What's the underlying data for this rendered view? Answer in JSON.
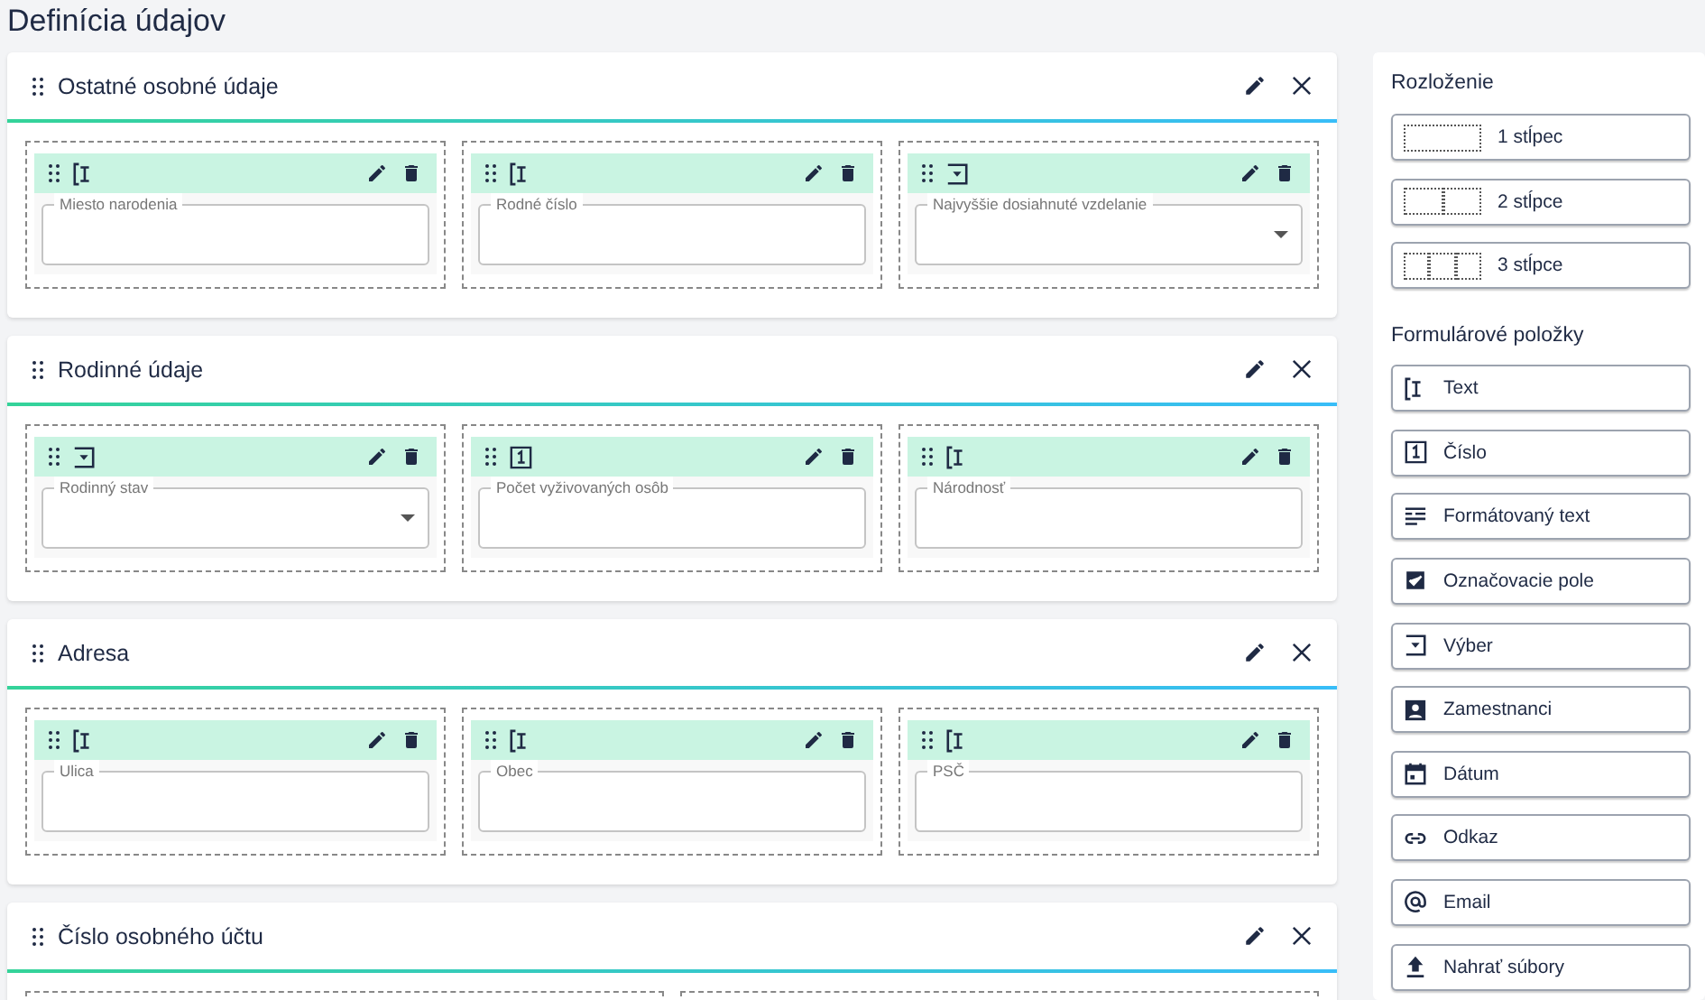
{
  "page_title": "Definícia údajov",
  "sections": [
    {
      "title": "Ostatné osobné údaje",
      "fields": [
        {
          "kind": "text",
          "label": "Miesto narodenia"
        },
        {
          "kind": "text",
          "label": "Rodné číslo"
        },
        {
          "kind": "select",
          "label": "Najvyššie dosiahnuté vzdelanie"
        }
      ]
    },
    {
      "title": "Rodinné údaje",
      "fields": [
        {
          "kind": "select",
          "label": "Rodinný stav"
        },
        {
          "kind": "number",
          "label": "Počet vyživovaných osôb"
        },
        {
          "kind": "text",
          "label": "Národnosť"
        }
      ]
    },
    {
      "title": "Adresa",
      "fields": [
        {
          "kind": "text",
          "label": "Ulica"
        },
        {
          "kind": "text",
          "label": "Obec"
        },
        {
          "kind": "text",
          "label": "PSČ"
        }
      ]
    },
    {
      "title": "Číslo osobného účtu",
      "fields": [
        {
          "kind": "empty"
        },
        {
          "kind": "empty"
        }
      ]
    }
  ],
  "sidebar": {
    "layout_heading": "Rozloženie",
    "layouts": [
      {
        "kind": "single",
        "label": "1 stĺpec"
      },
      {
        "kind": "double",
        "label": "2 stĺpce"
      },
      {
        "kind": "triple",
        "label": "3 stĺpce"
      }
    ],
    "items_heading": "Formulárové položky",
    "items": [
      {
        "kind": "text",
        "label": "Text"
      },
      {
        "kind": "number",
        "label": "Číslo"
      },
      {
        "kind": "richtext",
        "label": "Formátovaný text"
      },
      {
        "kind": "checkbox",
        "label": "Označovacie pole"
      },
      {
        "kind": "select",
        "label": "Výber"
      },
      {
        "kind": "employees",
        "label": "Zamestnanci"
      },
      {
        "kind": "date",
        "label": "Dátum"
      },
      {
        "kind": "link",
        "label": "Odkaz"
      },
      {
        "kind": "email",
        "label": "Email"
      },
      {
        "kind": "upload",
        "label": "Nahrať súbory"
      }
    ]
  }
}
